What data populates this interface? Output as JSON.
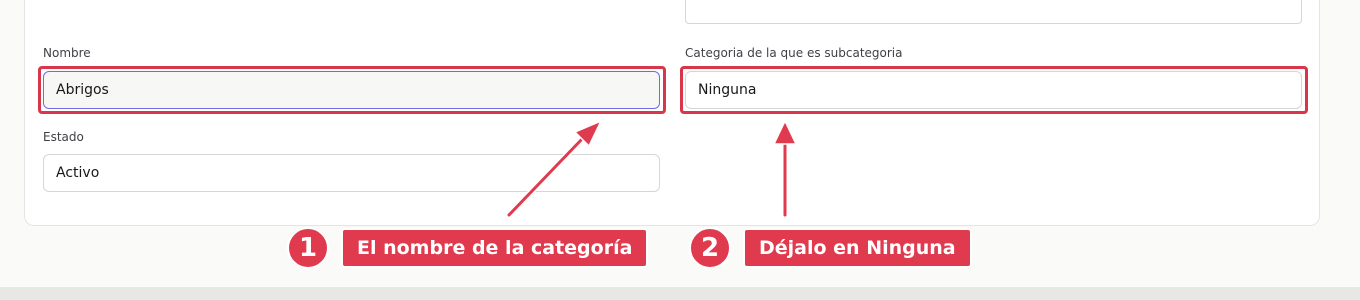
{
  "form": {
    "nombre_label": "Nombre",
    "nombre_value": "Abrigos",
    "subcategoria_label": "Categoria de la que es subcategoria",
    "subcategoria_value": "Ninguna",
    "estado_label": "Estado",
    "estado_value": "Activo"
  },
  "annotations": {
    "step1_number": "1",
    "step1_text": "El nombre de la categoría",
    "step2_number": "2",
    "step2_text": "Déjalo en Ninguna"
  },
  "colors": {
    "annotation_red": "#e03a4e",
    "highlight_red": "#d9364b",
    "focus_border": "#6b6ee8"
  }
}
